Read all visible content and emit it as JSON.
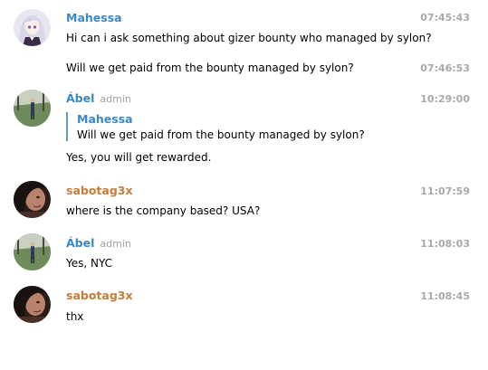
{
  "colors": {
    "name_blue": "#3a88c7",
    "name_orange": "#c77c3a",
    "timestamp": "#a9a9a9",
    "role": "#a0a0a0",
    "quote_bar": "#5b9bc9"
  },
  "messages": [
    {
      "author": "Mahessa",
      "avatar_icon": "anime-girl-avatar",
      "time": "07:45:43",
      "text": "Hi can i ask something about gizer bounty who managed by sylon?"
    },
    {
      "time": "07:46:53",
      "text": "Will we get paid from the bounty managed by sylon?"
    },
    {
      "author": "Ábel",
      "role": "admin",
      "avatar_icon": "outdoor-photo-avatar",
      "time": "10:29:00",
      "reply": {
        "author": "Mahessa",
        "text": "Will we get paid from the bounty managed by sylon?"
      },
      "text": "Yes, you will get rewarded."
    },
    {
      "author": "sabotag3x",
      "avatar_icon": "dark-portrait-avatar",
      "time": "11:07:59",
      "text": "where is the company based? USA?"
    },
    {
      "author": "Ábel",
      "role": "admin",
      "avatar_icon": "outdoor-photo-avatar",
      "time": "11:08:03",
      "text": "Yes, NYC"
    },
    {
      "author": "sabotag3x",
      "avatar_icon": "dark-portrait-avatar",
      "time": "11:08:45",
      "text": "thx"
    }
  ]
}
